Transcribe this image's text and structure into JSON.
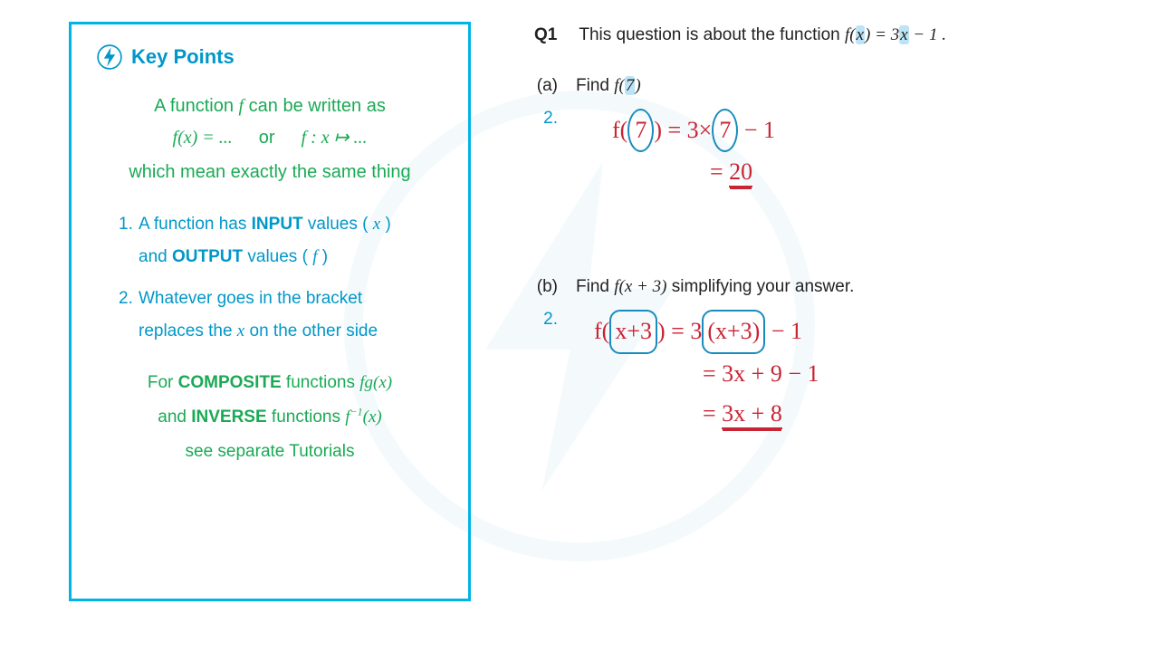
{
  "keypoints": {
    "title": "Key Points",
    "line1_a": "A function ",
    "line1_f": "f",
    "line1_b": " can be written as",
    "notation_left": "f(x) = ...",
    "notation_or": "or",
    "notation_right": "f : x ↦ ...",
    "line2": "which mean exactly the same thing",
    "list": {
      "item1_a": "A function has ",
      "item1_b": "INPUT",
      "item1_c": " values ( ",
      "item1_x": "x",
      "item1_d": " )",
      "item1_e": "and ",
      "item1_f": "OUTPUT",
      "item1_g": " values ( ",
      "item1_fv": "f",
      "item1_h": " )",
      "item2_a": "Whatever goes in the bracket",
      "item2_b": "replaces the ",
      "item2_x": "x",
      "item2_c": " on the other side"
    },
    "foot": {
      "l1_a": "For ",
      "l1_b": "COMPOSITE",
      "l1_c": " functions ",
      "l1_fn": "fg(x)",
      "l2_a": "and ",
      "l2_b": "INVERSE",
      "l2_c": " functions ",
      "l2_fn_a": "f",
      "l2_fn_sup": "−1",
      "l2_fn_b": "(x)",
      "l3": "see separate Tutorials"
    }
  },
  "q1": {
    "label": "Q1",
    "text_a": "This question is about the function ",
    "fn_a": "f(",
    "fn_x": "x",
    "fn_b": ") = 3",
    "fn_x2": "x",
    "fn_c": " − 1 .",
    "a": {
      "label": "(a)",
      "text_a": "Find ",
      "fn_a": "f(",
      "fn_7": "7",
      "fn_b": ")",
      "step": "2.",
      "hand_l1_a": "f(",
      "hand_l1_7": "7",
      "hand_l1_b": ") = 3×",
      "hand_l1_7b": "7",
      "hand_l1_c": " − 1",
      "hand_l2_a": "= ",
      "hand_l2_ans": "20"
    },
    "b": {
      "label": "(b)",
      "text_a": "Find ",
      "fn_a": "f(x + 3)",
      "text_b": "  simplifying your answer.",
      "step": "2.",
      "hand_l1_a": "f(",
      "hand_l1_arg": "x+3",
      "hand_l1_b": ") = 3",
      "hand_l1_arg2": "(x+3)",
      "hand_l1_c": " − 1",
      "hand_l2": "= 3x + 9 − 1",
      "hand_l3_a": "= ",
      "hand_l3_ans": "3x + 8"
    }
  }
}
